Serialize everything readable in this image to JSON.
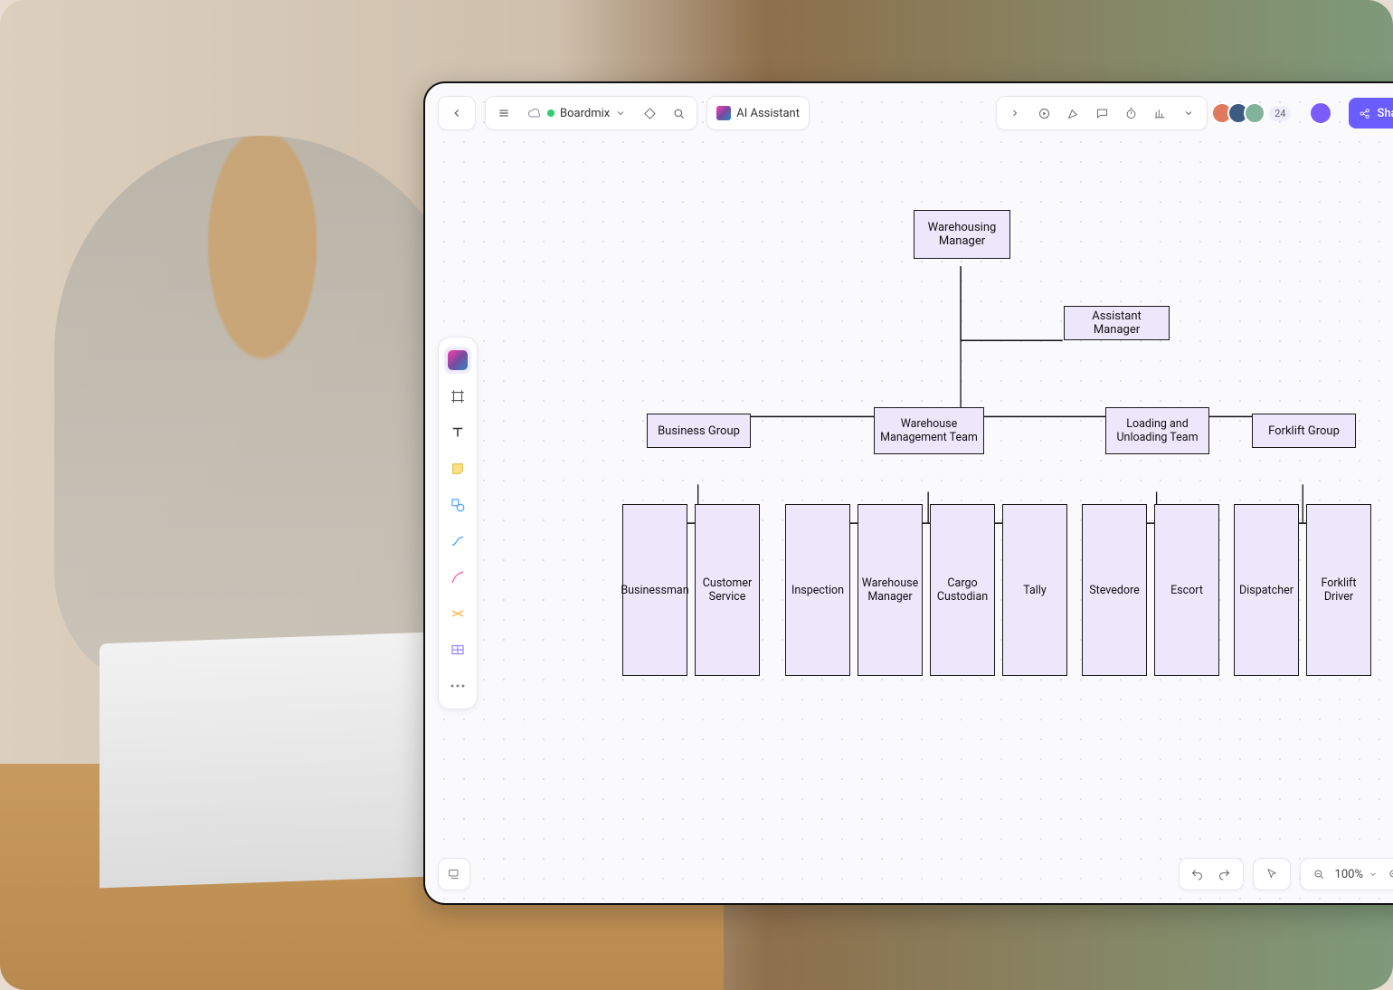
{
  "header": {
    "doc_name": "Boardmix",
    "ai_label": "AI Assistant",
    "participant_count": "24",
    "share_label": "Share"
  },
  "zoom": {
    "level": "100%"
  },
  "org": {
    "top": "Warehousing Manager",
    "assistant": "Assistant Manager",
    "groups": [
      {
        "name": "Business Group",
        "roles": [
          "Businessman",
          "Customer Service"
        ]
      },
      {
        "name": "Warehouse Management Team",
        "roles": [
          "Inspection",
          "Warehouse Manager",
          "Cargo Custodian",
          "Tally"
        ]
      },
      {
        "name": "Loading and Unloading Team",
        "roles": [
          "Stevedore",
          "Escort"
        ]
      },
      {
        "name": "Forklift Group",
        "roles": [
          "Dispatcher",
          "Forklift Driver"
        ]
      }
    ]
  }
}
